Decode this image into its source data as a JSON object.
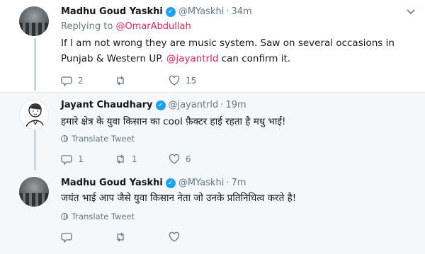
{
  "tweets": [
    {
      "name": "Madhu Goud Yaskhi",
      "verified_glyph": "✓",
      "handle": "@MYaskhi",
      "time": "34m",
      "replying_prefix": "Replying to",
      "replying_to": "@OmarAbdullah",
      "text_part1": "If I am not wrong they are music system. Saw on several occasions in Punjab & Western UP.",
      "mention": "@jayantrld",
      "text_part2": "can confirm it.",
      "reply_count": "2",
      "retweet_count": "",
      "like_count": "15"
    },
    {
      "name": "Jayant Chaudhary",
      "verified_glyph": "✓",
      "handle": "@jayantrld",
      "time": "19m",
      "text": "हमारे क्षेत्र के युवा किसान का cool फ़ैक्टर हाई रहता है मधु भाई!",
      "translate": "Translate Tweet",
      "reply_count": "1",
      "retweet_count": "1",
      "like_count": "6"
    },
    {
      "name": "Madhu Goud Yaskhi",
      "verified_glyph": "✓",
      "handle": "@MYaskhi",
      "time": "7m",
      "text": "जयंत भाई आप जैसे युवा किसान नेता जो उनके प्रतिनिधित्व करते है!",
      "translate": "Translate Tweet"
    }
  ],
  "separator_dot": "·",
  "colors": {
    "link": "#e0245e",
    "verified": "#1da1f2",
    "secondary": "#657786",
    "thread_line": "#ccd6dd"
  },
  "icons": [
    "reply-icon",
    "retweet-icon",
    "like-icon",
    "verified-badge-icon",
    "chevron-down-icon",
    "globe-icon"
  ]
}
